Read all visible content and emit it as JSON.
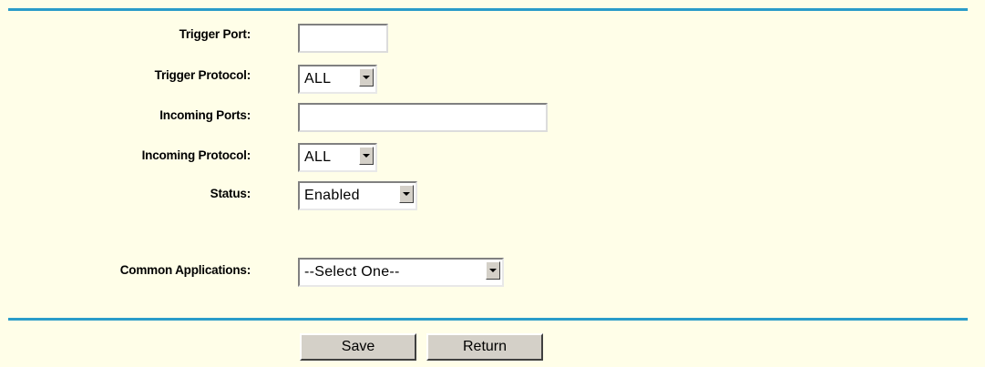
{
  "form": {
    "trigger_port": {
      "label": "Trigger Port:",
      "value": ""
    },
    "trigger_protocol": {
      "label": "Trigger Protocol:",
      "selected": "ALL"
    },
    "incoming_ports": {
      "label": "Incoming Ports:",
      "value": ""
    },
    "incoming_protocol": {
      "label": "Incoming Protocol:",
      "selected": "ALL"
    },
    "status": {
      "label": "Status:",
      "selected": "Enabled"
    },
    "common_applications": {
      "label": "Common Applications:",
      "selected": "--Select One--"
    }
  },
  "buttons": {
    "save_label": "Save",
    "return_label": "Return"
  },
  "colors": {
    "page_background": "#fffee8",
    "divider": "#2a9cc9",
    "button_face": "#d4d0c8"
  }
}
